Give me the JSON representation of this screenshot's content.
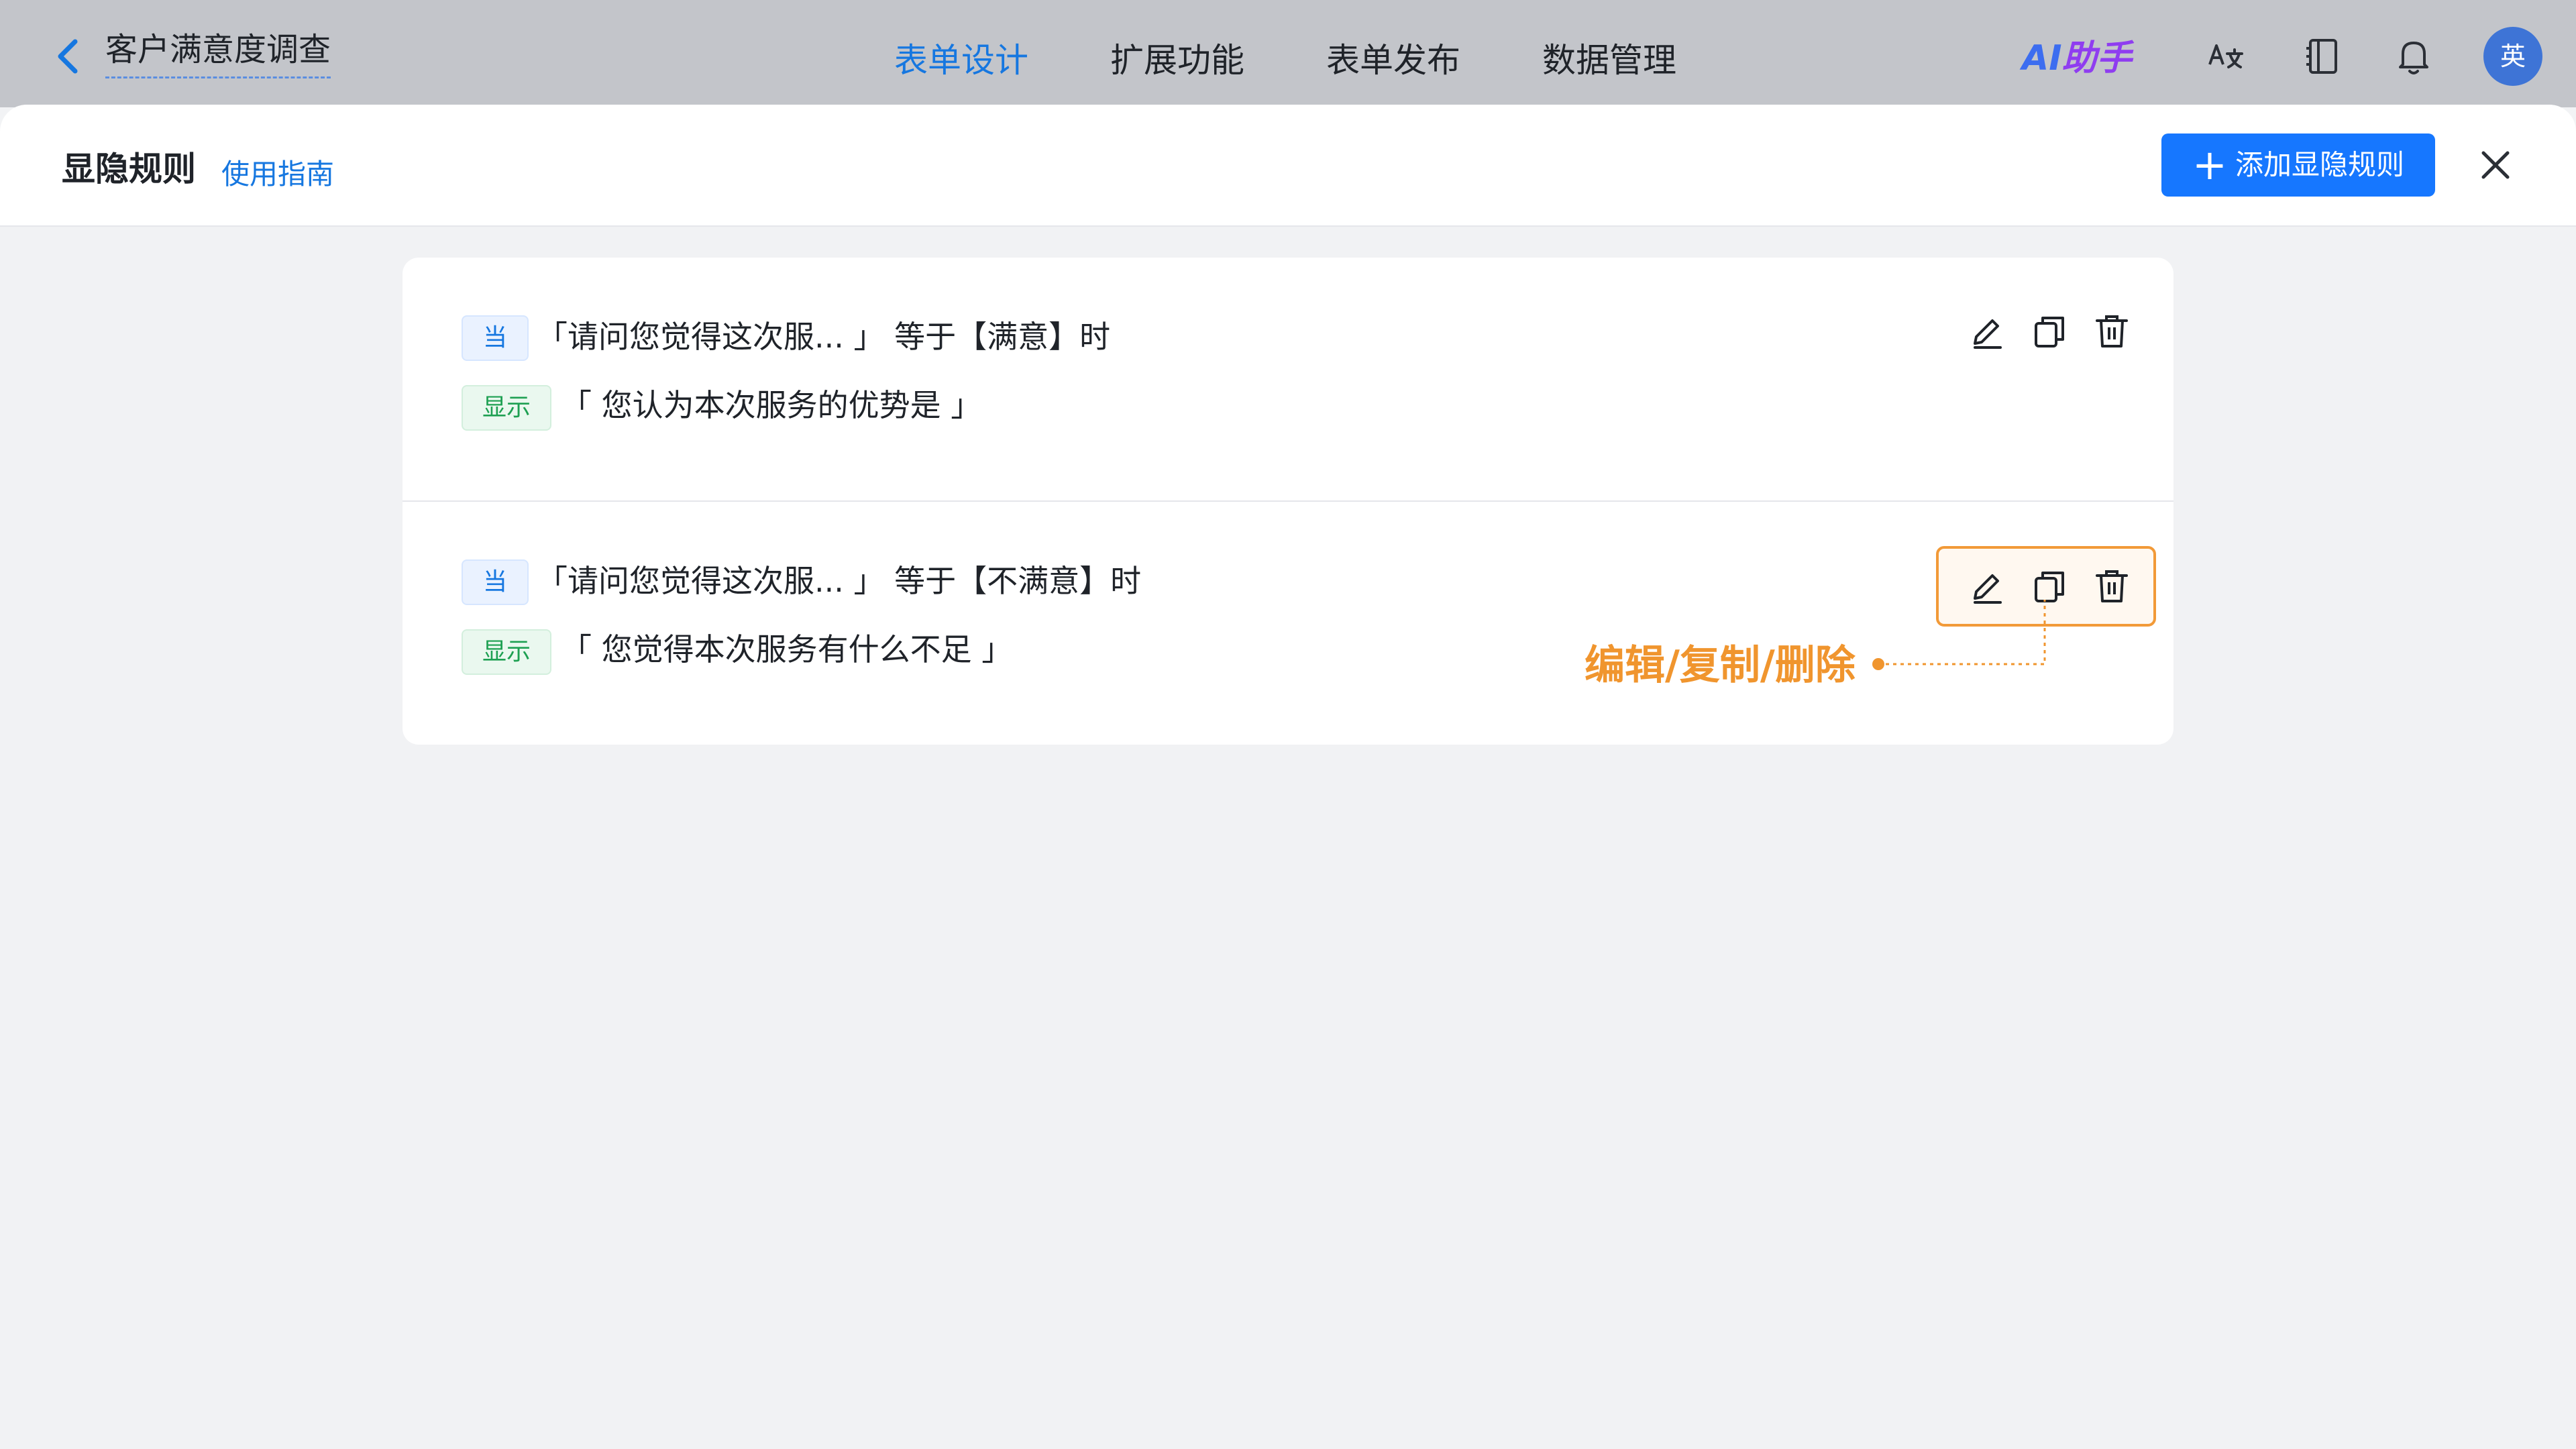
{
  "header": {
    "form_title": "客户满意度调查",
    "nav": [
      {
        "label": "表单设计",
        "active": true
      },
      {
        "label": "扩展功能",
        "active": false
      },
      {
        "label": "表单发布",
        "active": false
      },
      {
        "label": "数据管理",
        "active": false
      }
    ],
    "ai_assistant_a": "AI",
    "ai_assistant_b": "助手",
    "avatar_text": "英",
    "accent_color": "#1677e0"
  },
  "panel": {
    "title": "显隐规则",
    "guide_link": "使用指南",
    "add_button_label": "添加显隐规则",
    "add_button_plus": "+"
  },
  "rules": [
    {
      "when_tag": "当",
      "condition": "「请问您觉得这次服...  」 等于【满意】时",
      "show_tag": "显示",
      "target": "「 您认为本次服务的优势是 」"
    },
    {
      "when_tag": "当",
      "condition": "「请问您觉得这次服...  」 等于【不满意】时",
      "show_tag": "显示",
      "target": "「 您觉得本次服务有什么不足 」"
    }
  ],
  "annotation": {
    "text": "编辑/复制/删除",
    "color": "#f0952e"
  },
  "icons": [
    "back-icon",
    "translate-icon",
    "notebook-icon",
    "bell-icon",
    "edit-icon",
    "copy-icon",
    "trash-icon",
    "close-icon"
  ]
}
